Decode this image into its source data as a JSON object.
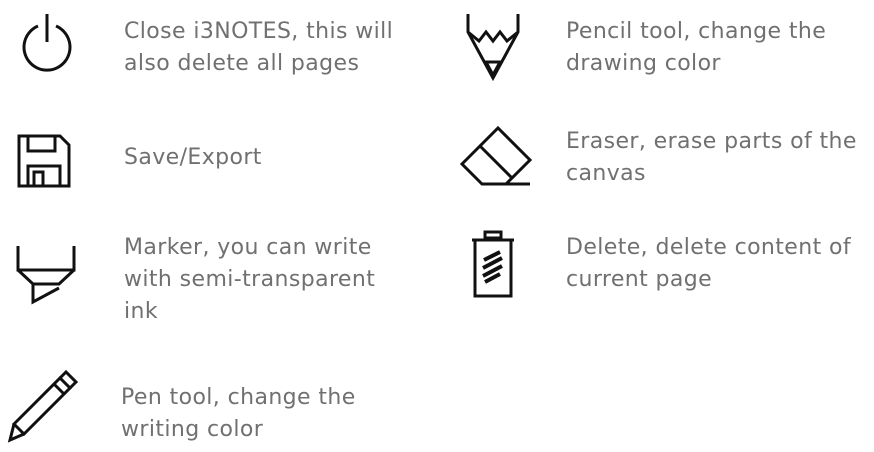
{
  "legend": {
    "left": [
      {
        "icon": "power-icon",
        "lines": [
          "Close i3NOTES, this will",
          "also delete all pages"
        ]
      },
      {
        "icon": "floppy-save-icon",
        "lines": [
          "Save/Export"
        ]
      },
      {
        "icon": "marker-icon",
        "lines": [
          "Marker, you can write",
          "with semi-transparent",
          "ink"
        ]
      },
      {
        "icon": "pen-icon",
        "lines": [
          "Pen tool, change the",
          "writing color"
        ]
      }
    ],
    "right": [
      {
        "icon": "pencil-icon",
        "lines": [
          "Pencil tool, change the",
          "drawing color"
        ]
      },
      {
        "icon": "eraser-icon",
        "lines": [
          "Eraser, erase parts of the",
          "canvas"
        ]
      },
      {
        "icon": "trash-icon",
        "lines": [
          "Delete, delete content of",
          "current page"
        ]
      }
    ]
  }
}
